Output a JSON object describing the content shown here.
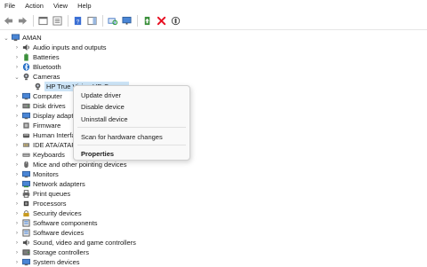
{
  "menu": [
    "File",
    "Action",
    "View",
    "Help"
  ],
  "toolbar": [
    {
      "icon": "back-arrow-icon"
    },
    {
      "icon": "forward-arrow-icon"
    },
    {
      "icon": "properties-window-icon"
    },
    {
      "icon": "list-view-icon"
    },
    {
      "icon": "help-book-icon"
    },
    {
      "icon": "action-pane-icon"
    },
    {
      "icon": "scan-hardware-icon"
    },
    {
      "icon": "monitor-icon"
    },
    {
      "icon": "update-driver-icon"
    },
    {
      "icon": "uninstall-x-icon"
    },
    {
      "icon": "enable-device-icon"
    }
  ],
  "tree": {
    "root": "AMAN",
    "items": [
      {
        "label": "Audio inputs and outputs",
        "icon": "speaker-icon"
      },
      {
        "label": "Batteries",
        "icon": "battery-icon"
      },
      {
        "label": "Bluetooth",
        "icon": "bluetooth-icon"
      },
      {
        "label": "Cameras",
        "icon": "camera-icon",
        "expanded": true
      },
      {
        "label": "HP True Vision HD Camera",
        "icon": "camera-icon",
        "child": true,
        "selected": true
      },
      {
        "label": "Computer",
        "icon": "computer-icon"
      },
      {
        "label": "Disk drives",
        "icon": "disk-icon"
      },
      {
        "label": "Display adapters",
        "icon": "display-icon"
      },
      {
        "label": "Firmware",
        "icon": "firmware-icon"
      },
      {
        "label": "Human Interface Devices",
        "icon": "hid-icon"
      },
      {
        "label": "IDE ATA/ATAPI controllers",
        "icon": "ide-icon"
      },
      {
        "label": "Keyboards",
        "icon": "keyboard-icon"
      },
      {
        "label": "Mice and other pointing devices",
        "icon": "mouse-icon"
      },
      {
        "label": "Monitors",
        "icon": "monitor-icon"
      },
      {
        "label": "Network adapters",
        "icon": "network-icon"
      },
      {
        "label": "Print queues",
        "icon": "printer-icon"
      },
      {
        "label": "Processors",
        "icon": "processor-icon"
      },
      {
        "label": "Security devices",
        "icon": "security-icon"
      },
      {
        "label": "Software components",
        "icon": "software-icon"
      },
      {
        "label": "Software devices",
        "icon": "software-icon"
      },
      {
        "label": "Sound, video and game controllers",
        "icon": "sound-icon"
      },
      {
        "label": "Storage controllers",
        "icon": "storage-icon"
      },
      {
        "label": "System devices",
        "icon": "system-icon"
      }
    ]
  },
  "context_menu": {
    "items": [
      "Update driver",
      "Disable device",
      "Uninstall device",
      "Scan for hardware changes",
      "Properties"
    ]
  },
  "colors": {
    "accent": "#0a64c8",
    "selection": "#cce4f7",
    "danger": "#e81123",
    "green": "#2e9e3e"
  }
}
